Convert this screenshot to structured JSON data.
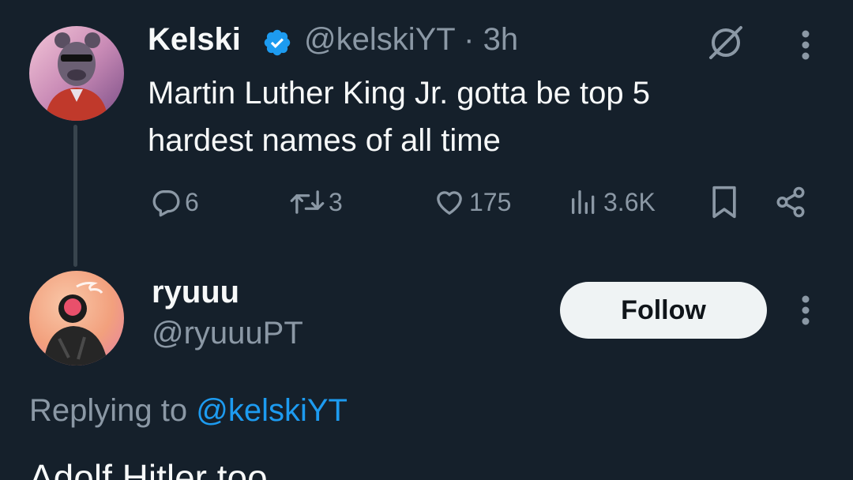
{
  "tweet": {
    "display_name": "Kelski",
    "verified": true,
    "handle": "@kelskiYT",
    "separator": "·",
    "time": "3h",
    "text": "Martin Luther King Jr. gotta be top 5 hardest names of all time",
    "actions": {
      "replies": "6",
      "retweets": "3",
      "likes": "175",
      "views": "3.6K"
    }
  },
  "reply": {
    "display_name": "ryuuu",
    "handle": "@ryuuuPT",
    "follow_label": "Follow",
    "replying_to_prefix": "Replying to",
    "replying_to_handle": "@kelskiYT",
    "text": "Adolf Hitler too"
  },
  "icons": {
    "verified": "verified-badge-icon",
    "grok": "grok-icon",
    "more": "more-dots-icon",
    "reply": "reply-bubble-icon",
    "retweet": "retweet-icon",
    "like": "heart-icon",
    "views": "views-bars-icon",
    "bookmark": "bookmark-icon",
    "share": "share-icon"
  },
  "colors": {
    "background": "#15202b",
    "text": "#f7f9f9",
    "muted": "#8b98a5",
    "accent": "#1d9bf0",
    "follow_bg": "#eff3f4"
  }
}
